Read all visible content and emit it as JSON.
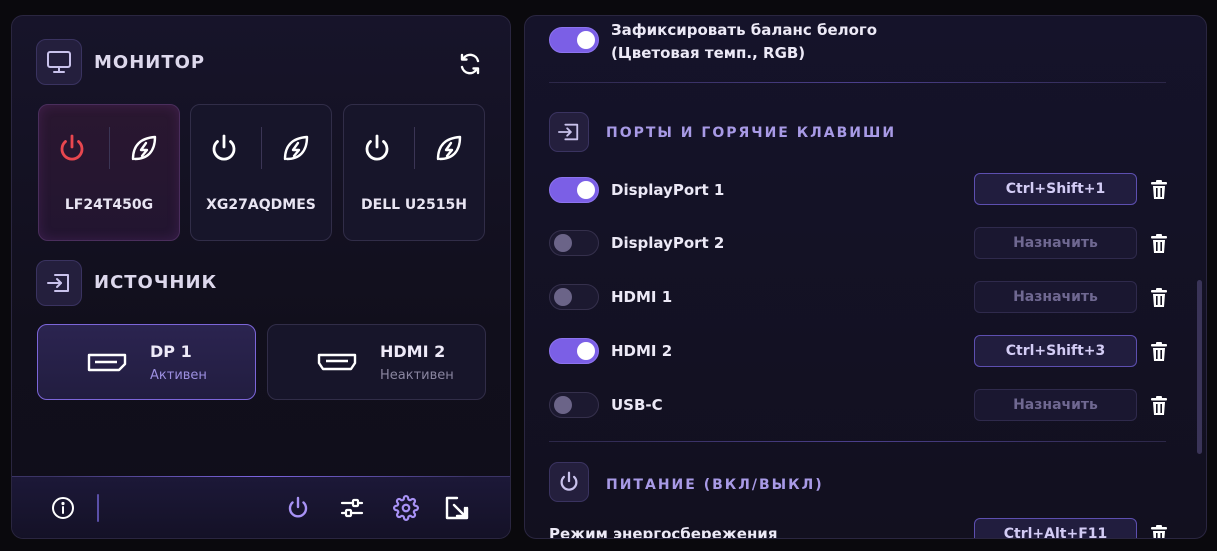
{
  "monitor_section": {
    "title": "МОНИТОР",
    "icon": "monitor-icon"
  },
  "monitors": [
    {
      "name": "LF24T450G",
      "selected": true,
      "power_color": "#e8474f"
    },
    {
      "name": "XG27AQDMES",
      "selected": false,
      "power_color": "#ffffff"
    },
    {
      "name": "DELL U2515H",
      "selected": false,
      "power_color": "#ffffff"
    }
  ],
  "source_section": {
    "title": "ИСТОЧНИК",
    "icon": "input-icon"
  },
  "sources": [
    {
      "name": "DP 1",
      "status": "Активен",
      "selected": true
    },
    {
      "name": "HDMI 2",
      "status": "Неактивен",
      "selected": false
    }
  ],
  "settings": {
    "white_balance": {
      "label_line1": "Зафиксировать баланс белого",
      "label_line2": "(Цветовая темп., RGB)",
      "on": true
    },
    "ports_section": {
      "title": "ПОРТЫ И ГОРЯЧИЕ КЛАВИШИ"
    },
    "ports": [
      {
        "name": "DisplayPort 1",
        "on": true,
        "hotkey": "Ctrl+Shift+1"
      },
      {
        "name": "DisplayPort 2",
        "on": false,
        "hotkey": "Назначить"
      },
      {
        "name": "HDMI 1",
        "on": false,
        "hotkey": "Назначить"
      },
      {
        "name": "HDMI 2",
        "on": true,
        "hotkey": "Ctrl+Shift+3"
      },
      {
        "name": "USB-C",
        "on": false,
        "hotkey": "Назначить"
      }
    ],
    "power_section": {
      "title": "ПИТАНИЕ (ВКЛ/ВЫКЛ)"
    },
    "power_rows": [
      {
        "name": "Режим энергосбережения",
        "hotkey": "Ctrl+Alt+F11"
      }
    ]
  },
  "colors": {
    "accent": "#7b5fe6",
    "power_active": "#e8474f",
    "muted_text": "#6f6891"
  }
}
